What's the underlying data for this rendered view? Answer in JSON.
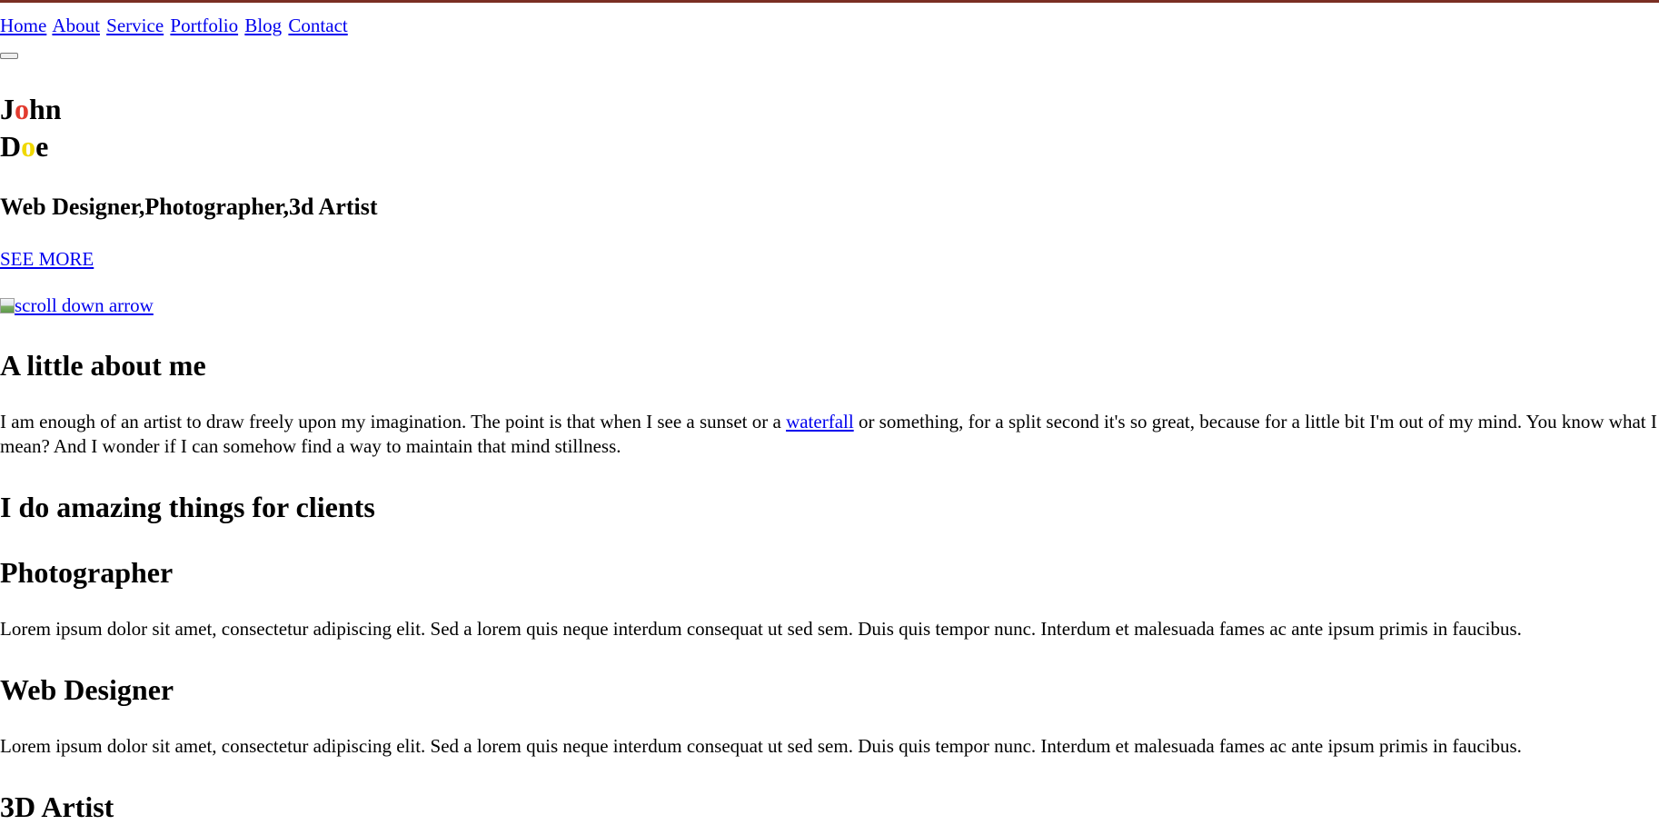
{
  "theme": {
    "top_border_color": "#7a2f23",
    "link_color": "#0000ee",
    "accent_red": "#e23b2f",
    "accent_yellow": "#f0d800"
  },
  "nav": {
    "items": [
      "Home",
      "About",
      "Service",
      "Portfolio",
      "Blog",
      "Contact"
    ]
  },
  "hero": {
    "first_name": {
      "pre": "J",
      "highlight": "o",
      "post": "hn"
    },
    "last_name": {
      "pre": "D",
      "highlight": "o",
      "post": "e"
    },
    "subtitle": "Web Designer,Photographer,3d Artist",
    "cta_label": "SEE MORE",
    "scroll_alt": "scroll down arrow",
    "scroll_icon": "broken-image-icon"
  },
  "about": {
    "heading": "A little about me",
    "text_before_link": "I am enough of an artist to draw freely upon my imagination. The point is that when I see a sunset or a ",
    "link_text": "waterfall",
    "text_after_link": " or something, for a split second it's so great, because for a little bit I'm out of my mind. You know what I mean? And I wonder if I can somehow find a way to maintain that mind stillness."
  },
  "services": {
    "heading": "I do amazing things for clients",
    "items": [
      {
        "title": "Photographer",
        "description": "Lorem ipsum dolor sit amet, consectetur adipiscing elit. Sed a lorem quis neque interdum consequat ut sed sem. Duis quis tempor nunc. Interdum et malesuada fames ac ante ipsum primis in faucibus."
      },
      {
        "title": "Web Designer",
        "description": "Lorem ipsum dolor sit amet, consectetur adipiscing elit. Sed a lorem quis neque interdum consequat ut sed sem. Duis quis tempor nunc. Interdum et malesuada fames ac ante ipsum primis in faucibus."
      },
      {
        "title": "3D Artist",
        "description": ""
      }
    ]
  }
}
